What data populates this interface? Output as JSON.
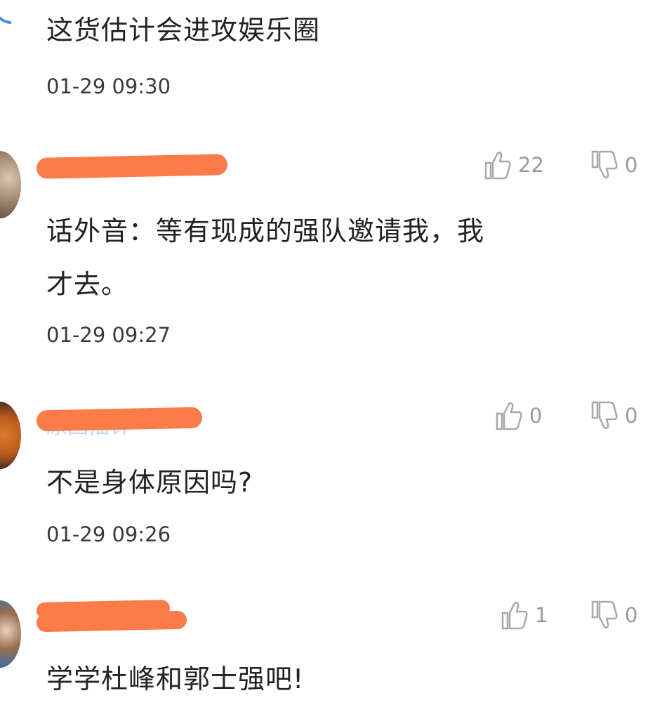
{
  "comments": [
    {
      "text": "这货估计会进攻娱乐圈",
      "time": "01-29 09:30"
    },
    {
      "text_line1": "话外音：等有现成的强队邀请我，我",
      "text_line2": "才去。",
      "time": "01-29 09:27",
      "likes": "22",
      "dislikes": "0"
    },
    {
      "username_hint": "原国插针",
      "text": "不是身体原因吗?",
      "time": "01-29 09:26",
      "likes": "0",
      "dislikes": "0"
    },
    {
      "text": "学学杜峰和郭士强吧!",
      "likes": "1",
      "dislikes": "0"
    }
  ],
  "colors": {
    "redaction": "#fb7b49",
    "verified_badge": "#4a90d9",
    "muted": "#9a9a9a"
  },
  "icons": {
    "like": "thumbs-up-icon",
    "dislike": "thumbs-down-icon"
  }
}
